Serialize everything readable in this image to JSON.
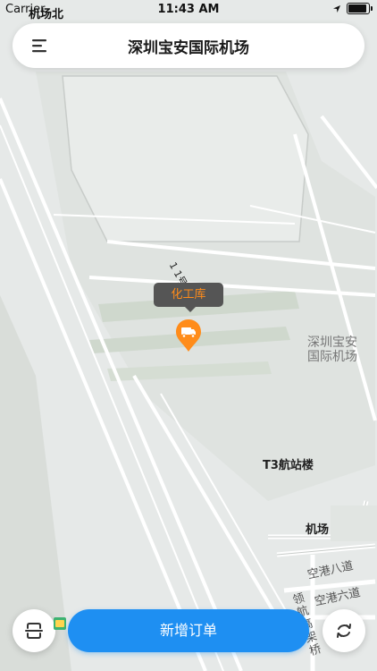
{
  "status_bar": {
    "carrier": "Carrier",
    "overlay_text": "机场北",
    "time": "11:43 AM"
  },
  "header": {
    "title": "深圳宝安国际机场"
  },
  "map": {
    "labels": {
      "airport_name_line1": "深圳宝安",
      "airport_name_line2": "国际机场",
      "terminal": "T3航站楼",
      "airport": "机场",
      "road_8": "空港八道",
      "road_6": "空港六道",
      "road_tilted": "1 1号",
      "bridge_vertical": "领航高架桥"
    },
    "poi": {
      "tooltip": "化工库",
      "icon": "truck-icon"
    }
  },
  "actions": {
    "new_order_label": "新增订单",
    "scan_icon": "scan-icon",
    "refresh_icon": "refresh-icon"
  },
  "colors": {
    "accent": "#1e8ff2",
    "poi": "#ff8c1a",
    "tooltip_bg": "#555555"
  }
}
